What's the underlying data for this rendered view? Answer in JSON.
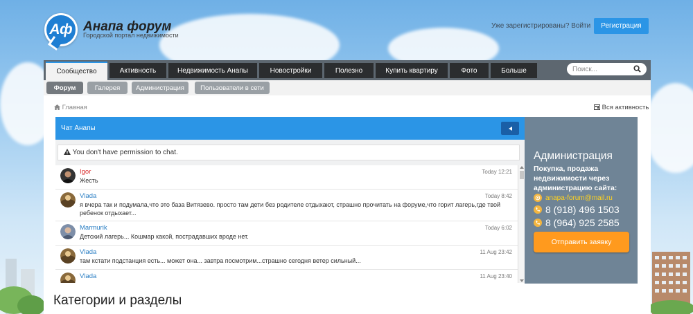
{
  "header": {
    "logo_text": "Аф",
    "title": "Анапа форум",
    "subtitle": "Городской портал недвижимости",
    "login_text": "Уже зарегистрированы? Войти",
    "register_label": "Регистрация"
  },
  "nav": {
    "tabs": [
      {
        "label": "Сообщество",
        "active": true
      },
      {
        "label": "Активность"
      },
      {
        "label": "Недвижимость Анапы"
      },
      {
        "label": "Новостройки"
      },
      {
        "label": "Полезно"
      },
      {
        "label": "Купить квартиру"
      },
      {
        "label": "Фото"
      },
      {
        "label": "Больше"
      }
    ],
    "search_placeholder": "Поиск..."
  },
  "subnav": {
    "tabs": [
      {
        "label": "Форум",
        "active": true
      },
      {
        "label": "Галерея"
      },
      {
        "label": "Администрация"
      },
      {
        "label": "Пользователи в сети"
      }
    ]
  },
  "breadcrumb": "Главная",
  "all_activity": "Вся активность",
  "chat": {
    "title": "Чат Анапы",
    "permission": "You don't have permission to chat.",
    "messages": [
      {
        "name": "Igor",
        "time": "Today 12:21",
        "text": "Жесть"
      },
      {
        "name": "Vlada",
        "time": "Today 8:42",
        "text": "я вчера так и подумала,что это база Витязево. просто там дети без родителе отдыхают, страшно прочитать на форуме,что горит лагерь,где твой ребенок отдыхает..."
      },
      {
        "name": "Marmurik",
        "time": "Today 6:02",
        "text": "Детский лагерь... Кошмар какой, пострадавших вроде нет."
      },
      {
        "name": "Vlada",
        "time": "11 Aug 23:42",
        "text": "там кстати подстанция есть... может она... завтра посмотрим...страшно сегодня ветер сильный..."
      },
      {
        "name": "Vlada",
        "time": "11 Aug 23:40",
        "text": ""
      }
    ]
  },
  "admin": {
    "title": "Администрация",
    "text": "Покупка, продажа недвижимости через администрацию сайта:",
    "email": "anapa-forum@mail.ru",
    "phone1": "8 (918) 496 1503",
    "phone2": "8 (964) 925 2585",
    "apply_label": "Отправить заявку"
  },
  "categories_title": "Категории и разделы",
  "colors": {
    "accent": "#2b95e6",
    "nav_dark": "#2b2d2f",
    "admin_bg": "#6f8496",
    "apply": "#ff9a1e",
    "email": "#ffd21e"
  }
}
